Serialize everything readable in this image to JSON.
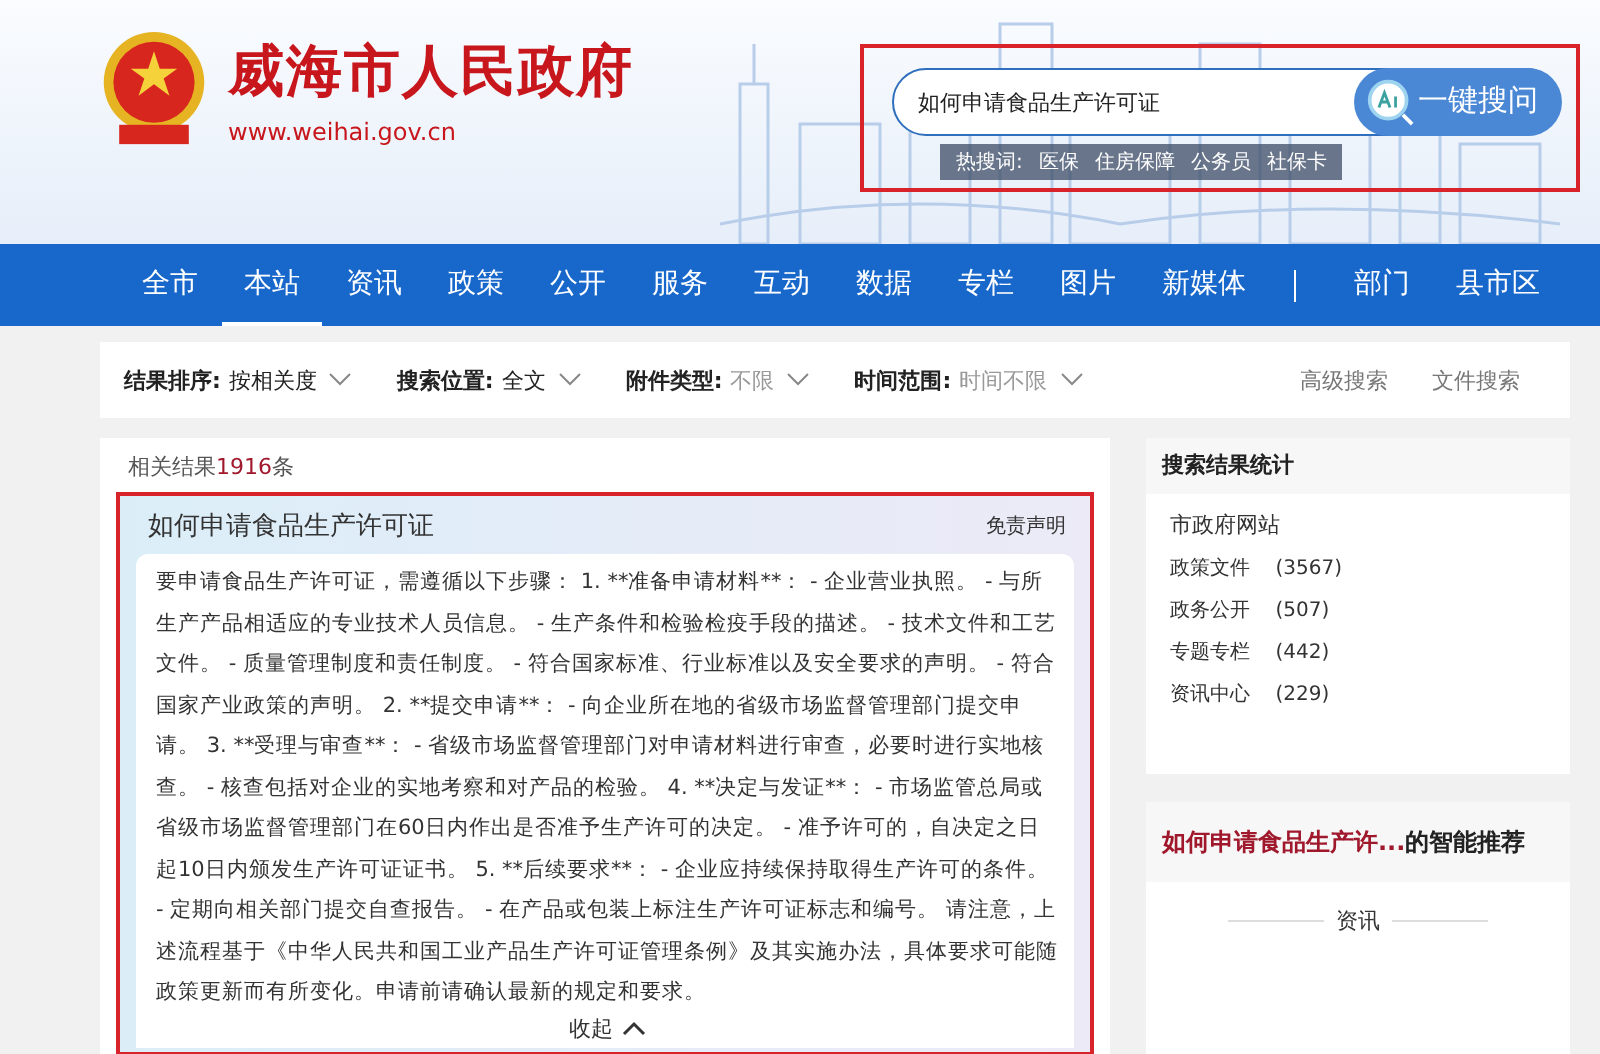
{
  "header": {
    "site_title": "威海市人民政府",
    "site_url": "www.weihai.gov.cn"
  },
  "search": {
    "value": "如何申请食品生产许可证",
    "button": "一键搜问",
    "hot_label": "热搜词:",
    "hot_words": [
      "医保",
      "住房保障",
      "公务员",
      "社保卡"
    ]
  },
  "nav": {
    "items": [
      {
        "label": "全市",
        "selected": false
      },
      {
        "label": "本站",
        "selected": true
      },
      {
        "label": "资讯",
        "selected": false
      },
      {
        "label": "政策",
        "selected": false
      },
      {
        "label": "公开",
        "selected": false
      },
      {
        "label": "服务",
        "selected": false
      },
      {
        "label": "互动",
        "selected": false
      },
      {
        "label": "数据",
        "selected": false
      },
      {
        "label": "专栏",
        "selected": false
      },
      {
        "label": "图片",
        "selected": false
      },
      {
        "label": "新媒体",
        "selected": false
      }
    ],
    "right_items": [
      {
        "label": "部门",
        "selected": false
      },
      {
        "label": "县市区",
        "selected": false
      }
    ]
  },
  "filters": [
    {
      "label": "结果排序:",
      "value": "按相关度",
      "dimmed": false
    },
    {
      "label": "搜索位置:",
      "value": "全文",
      "dimmed": false
    },
    {
      "label": "附件类型:",
      "value": "不限",
      "dimmed": true
    },
    {
      "label": "时间范围:",
      "value": "时间不限",
      "dimmed": true
    }
  ],
  "filter_links": [
    "高级搜索",
    "文件搜索"
  ],
  "results": {
    "prefix": "相关结果",
    "count": "1916",
    "suffix": "条"
  },
  "answer": {
    "title": "如何申请食品生产许可证",
    "disclaimer": "免责声明",
    "text": "要申请食品生产许可证，需遵循以下步骤： 1. **准备申请材料**： - 企业营业执照。 - 与所生产产品相适应的专业技术人员信息。 - 生产条件和检验检疫手段的描述。 - 技术文件和工艺文件。 - 质量管理制度和责任制度。 - 符合国家标准、行业标准以及安全要求的声明。 - 符合国家产业政策的声明。 2. **提交申请**： - 向企业所在地的省级市场监督管理部门提交申请。 3. **受理与审查**： - 省级市场监督管理部门对申请材料进行审查，必要时进行实地核查。 - 核查包括对企业的实地考察和对产品的检验。 4. **决定与发证**： - 市场监管总局或省级市场监督管理部门在60日内作出是否准予生产许可的决定。 - 准予许可的，自决定之日起10日内颁发生产许可证证书。 5. **后续要求**： - 企业应持续保持取得生产许可的条件。 - 定期向相关部门提交自查报告。 - 在产品或包装上标注生产许可证标志和编号。 请注意，上述流程基于《中华人民共和国工业产品生产许可证管理条例》及其实施办法，具体要求可能随政策更新而有所变化。申请前请确认最新的规定和要求。",
    "collapse": "收起"
  },
  "stats": {
    "title": "搜索结果统计",
    "group": "市政府网站",
    "items": [
      {
        "name": "政策文件",
        "count": "(3567)"
      },
      {
        "name": "政务公开",
        "count": "(507)"
      },
      {
        "name": "专题专栏",
        "count": "(442)"
      },
      {
        "name": "资讯中心",
        "count": "(229)"
      }
    ]
  },
  "recommend": {
    "query": "如何申请食品生产许...",
    "suffix": "的智能推荐",
    "tab": "资讯"
  }
}
